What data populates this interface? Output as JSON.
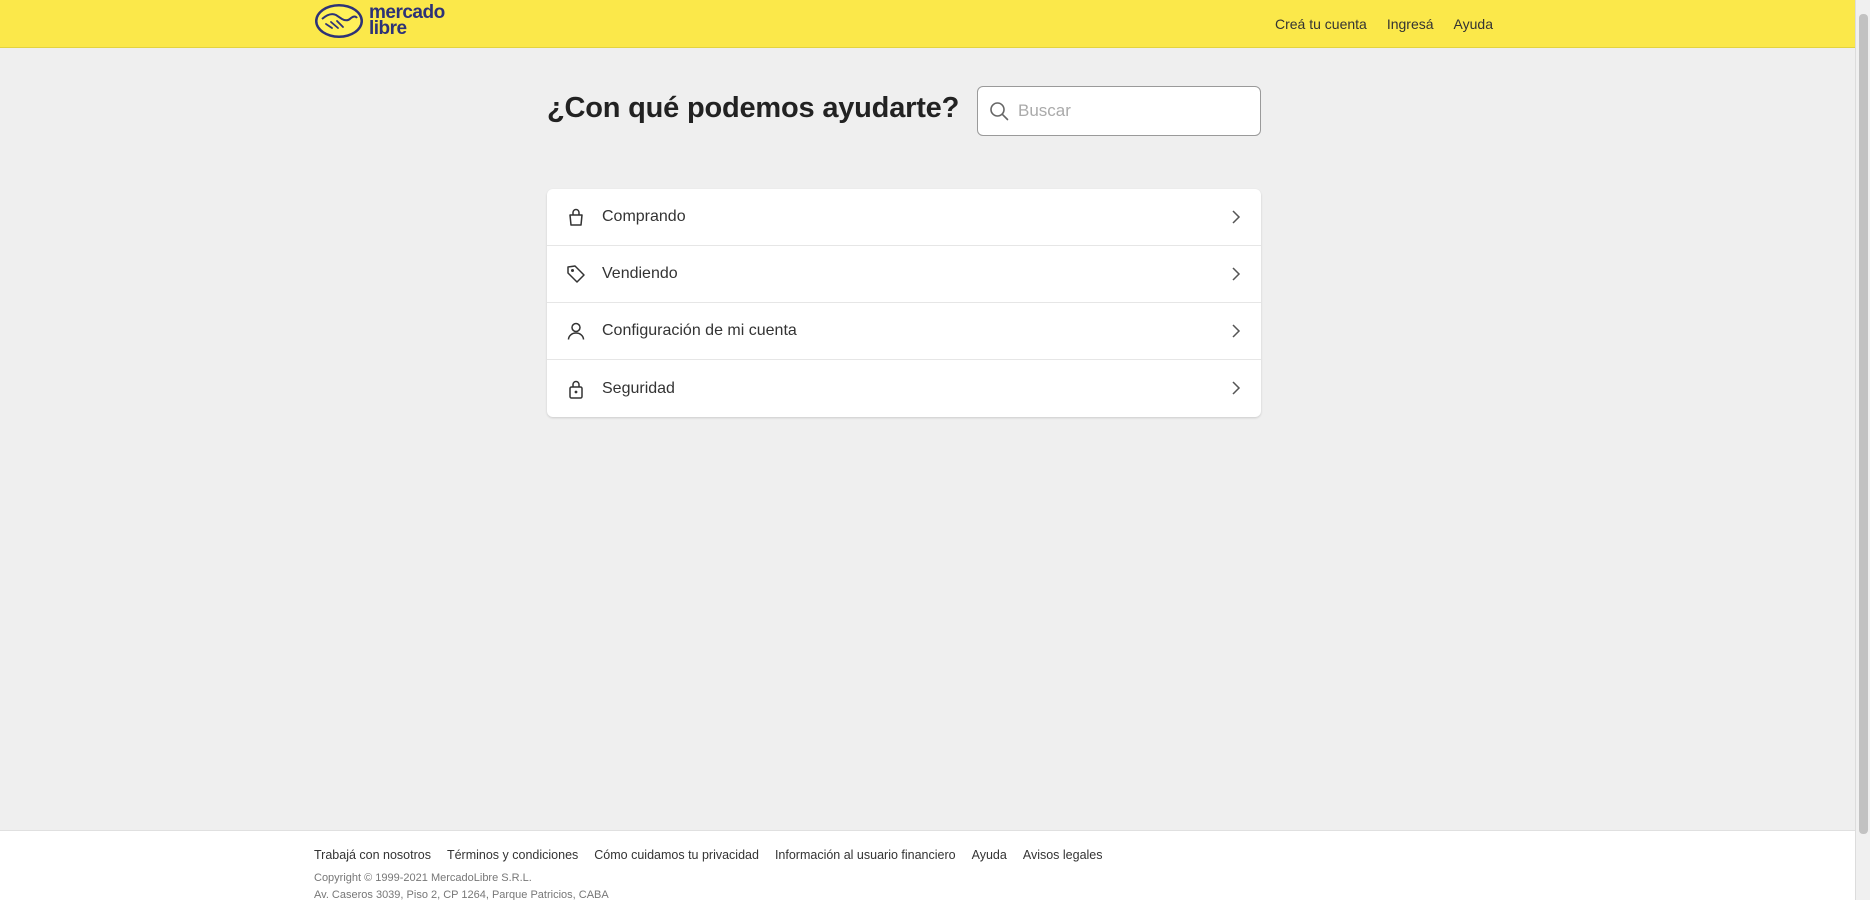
{
  "header": {
    "brand_line1": "mercado",
    "brand_line2": "libre",
    "nav": [
      "Creá tu cuenta",
      "Ingresá",
      "Ayuda"
    ],
    "background": "#fbe84a"
  },
  "main": {
    "title": "¿Con qué podemos ayudarte?",
    "search": {
      "placeholder": "Buscar",
      "value": ""
    },
    "topics": [
      {
        "label": "Comprando",
        "icon": "shopping-bag-icon"
      },
      {
        "label": "Vendiendo",
        "icon": "price-tag-icon"
      },
      {
        "label": "Configuración de mi cuenta",
        "icon": "user-icon"
      },
      {
        "label": "Seguridad",
        "icon": "lock-icon"
      }
    ]
  },
  "footer": {
    "links": [
      "Trabajá con nosotros",
      "Términos y condiciones",
      "Cómo cuidamos tu privacidad",
      "Información al usuario financiero",
      "Ayuda",
      "Avisos legales"
    ],
    "copyright": "Copyright © 1999-2021 MercadoLibre S.R.L.",
    "address": "Av. Caseros 3039, Piso 2, CP 1264, Parque Patricios, CABA"
  }
}
